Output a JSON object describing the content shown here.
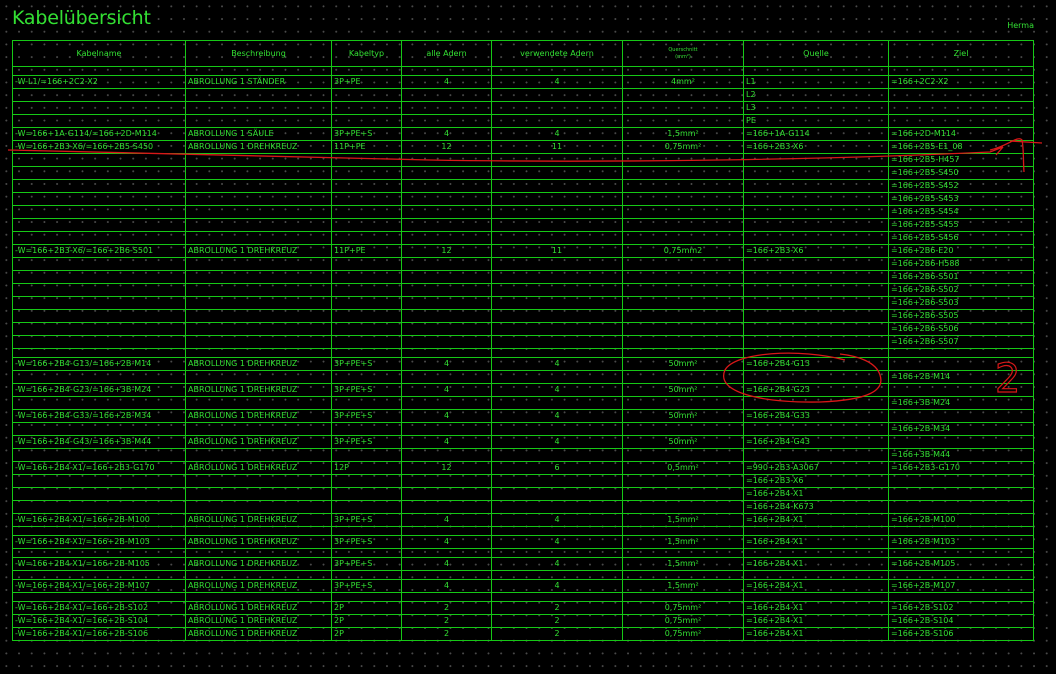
{
  "title": "Kabelübersicht",
  "author": "Herma",
  "columns": [
    "Kabelname",
    "Beschreibung",
    "Kabeltyp",
    "alle Adern",
    "verwendete Adern",
    "Querschnitt",
    "(mm²)",
    "Quelle",
    "Ziel"
  ],
  "rows": [
    {
      "gap": true
    },
    {
      "name": "-W-L1/=166+2C2-X2",
      "desc": "ABROLLUNG 1 STÄNDER",
      "typ": "3P+PE",
      "alle": "4",
      "verw": "4",
      "qs": "4mm²",
      "quelle": "L1",
      "ziel": "=166+2C2-X2"
    },
    {
      "quelle": "L2"
    },
    {
      "quelle": "L3"
    },
    {
      "quelle": "PE"
    },
    {
      "name": "-W=166+1A-G114/=166+2D-M114",
      "desc": "ABROLLUNG 1 SÄULE",
      "typ": "3P+PE+S",
      "alle": "4",
      "verw": "4",
      "qs": "1,5mm²",
      "quelle": "=166+1A-G114",
      "ziel": "=166+2D-M114"
    },
    {
      "name": "-W=166+2B3-X6/=166+2B5-S450",
      "desc": "ABROLLUNG 1 DREHKREUZ",
      "typ": "11P+PE",
      "alle": "12",
      "verw": "11",
      "qs": "0,75mm²",
      "quelle": "=166+2B3-X6",
      "ziel": "=166+2B5-E1_08"
    },
    {
      "ziel": "=166+2B5-H457"
    },
    {
      "ziel": "=166+2B5-S450"
    },
    {
      "ziel": "=166+2B5-S452"
    },
    {
      "ziel": "=166+2B5-S453"
    },
    {
      "ziel": "=166+2B5-S454"
    },
    {
      "ziel": "=166+2B5-S455"
    },
    {
      "ziel": "=166+2B5-S456"
    },
    {
      "name": "-W=166+2B3-X6/=166+2B6-S501",
      "desc": "ABROLLUNG 1 DREHKREUZ",
      "typ": "11P+PE",
      "alle": "12",
      "verw": "11",
      "qs": "0,75mm2",
      "quelle": "=166+2B3-X6",
      "ziel": "=166+2B6-E20"
    },
    {
      "ziel": "=166+2B6-H588"
    },
    {
      "ziel": "=166+2B6-S501"
    },
    {
      "ziel": "=166+2B6-S502"
    },
    {
      "ziel": "=166+2B6-S503"
    },
    {
      "ziel": "=166+2B6-S505"
    },
    {
      "ziel": "=166+2B6-S506"
    },
    {
      "ziel": "=166+2B6-S507"
    },
    {
      "gap": true
    },
    {
      "name": "-W=166+2B4-G13/=166+2B-M14",
      "desc": "ABROLLUNG 1 DREHKREUZ",
      "typ": "3P+PE+S",
      "alle": "4",
      "verw": "4",
      "qs": "50mm²",
      "quelle": "=166+2B4-G13",
      "ziel": ""
    },
    {
      "ziel": "=166+2B-M14"
    },
    {
      "name": "-W=166+2B4-G23/=166+3B-M24",
      "desc": "ABROLLUNG 1 DREHKREUZ",
      "typ": "3P+PE+S",
      "alle": "4",
      "verw": "4",
      "qs": "50mm²",
      "quelle": "=166+2B4-G23",
      "ziel": ""
    },
    {
      "ziel": "=166+3B-M24"
    },
    {
      "name": "-W=166+2B4-G33/=166+2B-M34",
      "desc": "ABROLLUNG 1 DREHKREUZ",
      "typ": "3P+PE+S",
      "alle": "4",
      "verw": "4",
      "qs": "50mm²",
      "quelle": "=166+2B4-G33",
      "ziel": ""
    },
    {
      "ziel": "=166+2B-M34"
    },
    {
      "name": "-W=166+2B4-G43/=166+3B-M44",
      "desc": "ABROLLUNG 1 DREHKREUZ",
      "typ": "3P+PE+S",
      "alle": "4",
      "verw": "4",
      "qs": "50mm²",
      "quelle": "=166+2B4-G43",
      "ziel": ""
    },
    {
      "ziel": "=166+3B-M44"
    },
    {
      "name": "-W=166+2B4-X1/=166+2B3-G170",
      "desc": "ABROLLUNG 1 DREHKREUZ",
      "typ": "12P",
      "alle": "12",
      "verw": "6",
      "qs": "0,5mm²",
      "quelle": "=990+2B3-A3067",
      "ziel": "=166+2B3-G170"
    },
    {
      "quelle": "=166+2B3-X6"
    },
    {
      "quelle": "=166+2B4-X1"
    },
    {
      "quelle": "=166+2B4-K673"
    },
    {
      "name": "-W=166+2B4-X1/=166+2B-M100",
      "desc": "ABROLLUNG 1 DREHKREUZ",
      "typ": "3P+PE+S",
      "alle": "4",
      "verw": "4",
      "qs": "1,5mm²",
      "quelle": "=166+2B4-X1",
      "ziel": "=166+2B-M100"
    },
    {
      "gap": true
    },
    {
      "name": "-W=166+2B4-X1/=166+2B-M103",
      "desc": "ABROLLUNG 1 DREHKREUZ",
      "typ": "3P+PE+S",
      "alle": "4",
      "verw": "4",
      "qs": "1,5mm²",
      "quelle": "=166+2B4-X1",
      "ziel": "=166+2B-M103"
    },
    {
      "gap": true
    },
    {
      "name": "-W=166+2B4-X1/=166+2B-M105",
      "desc": "ABROLLUNG 1 DREHKREUZ",
      "typ": "3P+PE+S",
      "alle": "4",
      "verw": "4",
      "qs": "1,5mm²",
      "quelle": "=166+2B4-X1",
      "ziel": "=166+2B-M105"
    },
    {
      "gap": true
    },
    {
      "name": "-W=166+2B4-X1/=166+2B-M107",
      "desc": "ABROLLUNG 1 DREHKREUZ",
      "typ": "3P+PE+S",
      "alle": "4",
      "verw": "4",
      "qs": "1,5mm²",
      "quelle": "=166+2B4-X1",
      "ziel": "=166+2B-M107"
    },
    {
      "gap": true
    },
    {
      "name": "-W=166+2B4-X1/=166+2B-S102",
      "desc": "ABROLLUNG 1 DREHKREUZ",
      "typ": "2P",
      "alle": "2",
      "verw": "2",
      "qs": "0,75mm²",
      "quelle": "=166+2B4-X1",
      "ziel": "=166+2B-S102"
    },
    {
      "name": "-W=166+2B4-X1/=166+2B-S104",
      "desc": "ABROLLUNG 1 DREHKREUZ",
      "typ": "2P",
      "alle": "2",
      "verw": "2",
      "qs": "0,75mm²",
      "quelle": "=166+2B4-X1",
      "ziel": "=166+2B-S104"
    },
    {
      "name": "-W=166+2B4-X1/=166+2B-S106",
      "desc": "ABROLLUNG 1 DREHKREUZ",
      "typ": "2P",
      "alle": "2",
      "verw": "2",
      "qs": "0,75mm²",
      "quelle": "=166+2B4-X1",
      "ziel": "=166+2B-S106"
    }
  ],
  "annotations": [
    {
      "type": "underline",
      "label": "red-underline-row-saeule",
      "color": "#d81818"
    },
    {
      "type": "circle",
      "label": "red-circle-quelle-g13-g23",
      "color": "#d81818"
    },
    {
      "type": "number",
      "text": "2",
      "color": "#d81818"
    }
  ]
}
